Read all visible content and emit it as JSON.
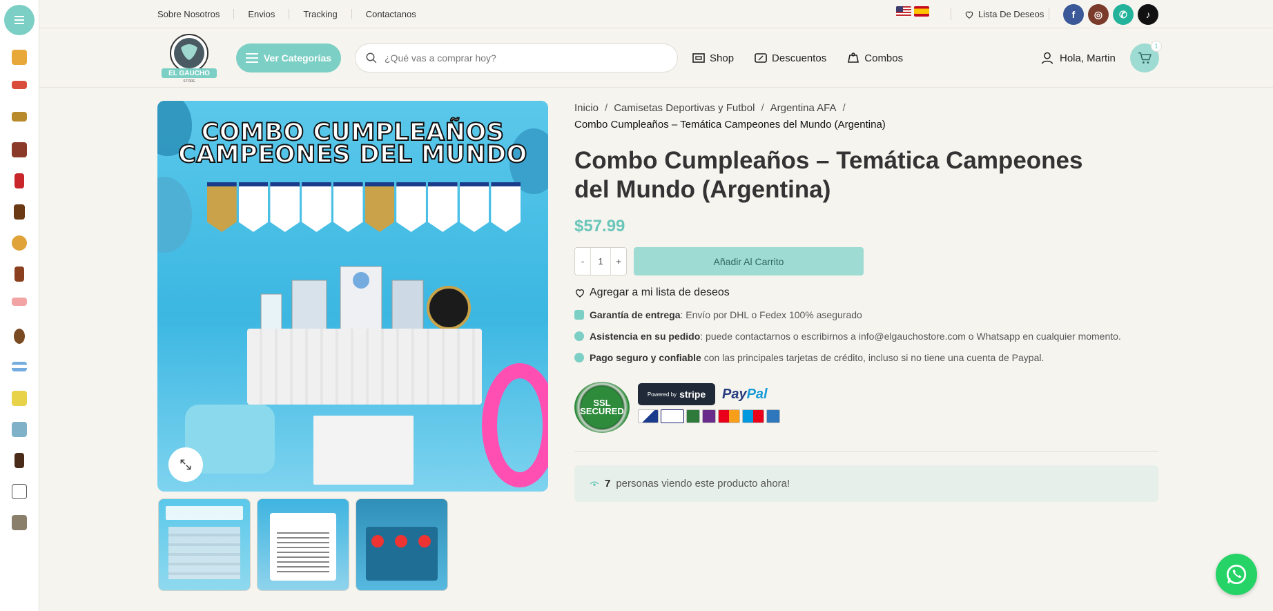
{
  "top_links": [
    "Sobre Nosotros",
    "Envios",
    "Tracking",
    "Contactanos"
  ],
  "languages": [
    "English",
    "Español"
  ],
  "wishlist_top": "Lista De Deseos",
  "socials": [
    "facebook",
    "instagram",
    "whatsapp",
    "tiktok"
  ],
  "rail": {
    "categories": [
      "alfajores-icon",
      "galletitas-icon",
      "snacks-icon",
      "chocolates-icon",
      "golosinas-icon",
      "dulce-de-leche-icon",
      "yerba-icon",
      "barras-icon",
      "caramelos-icon",
      "mate-icon",
      "argentina-flag-icon",
      "quesos-icon",
      "combos-icon",
      "bebidas-icon",
      "camisetas-icon",
      "libros-icon"
    ]
  },
  "header": {
    "logo_text": "EL GAUCHO",
    "logo_sub": "STORE",
    "categories_button": "Ver Categorías",
    "search_placeholder": "¿Qué vas a comprar hoy?",
    "nav": [
      "Shop",
      "Descuentos",
      "Combos"
    ],
    "user_greeting": "Hola, Martin",
    "cart_count": "1"
  },
  "product": {
    "image_title_line1": "COMBO CUMPLEAÑOS",
    "image_title_line2": "CAMPEONES DEL MUNDO",
    "breadcrumb": [
      "Inicio",
      "Camisetas Deportivas y Futbol",
      "Argentina AFA"
    ],
    "breadcrumb_current": "Combo Cumpleaños – Temática Campeones del Mundo (Argentina)",
    "title": "Combo Cumpleaños – Temática Campeones del Mundo (Argentina)",
    "price": "$57.99",
    "qty_minus": "-",
    "qty_value": "1",
    "qty_plus": "+",
    "add_to_cart": "Añadir Al Carrito",
    "add_to_wishlist": "Agregar a mi lista de deseos",
    "features": [
      {
        "label": "Garantía de entrega",
        "text": ": Envío por DHL o Fedex 100% asegurado"
      },
      {
        "label": "Asistencia en su pedido",
        "text": ": puede contactarnos o escribirnos a info@elgauchostore.com o Whatsapp en cualquier momento."
      },
      {
        "label": "Pago seguro y confiable",
        "text": " con las principales tarjetas de crédito, incluso si no tiene una cuenta de Paypal."
      }
    ],
    "ssl_badge": "SSL SECURED",
    "stripe_prefix": "Powered by",
    "stripe_name": "stripe",
    "paypal_pay": "Pay",
    "paypal_pal": "Pal",
    "viewers_count": "7",
    "viewers_text": "personas viendo este producto ahora!"
  },
  "colors": {
    "accent": "#7ccfc4",
    "price": "#6ac6b9",
    "whatsapp": "#25d366"
  }
}
